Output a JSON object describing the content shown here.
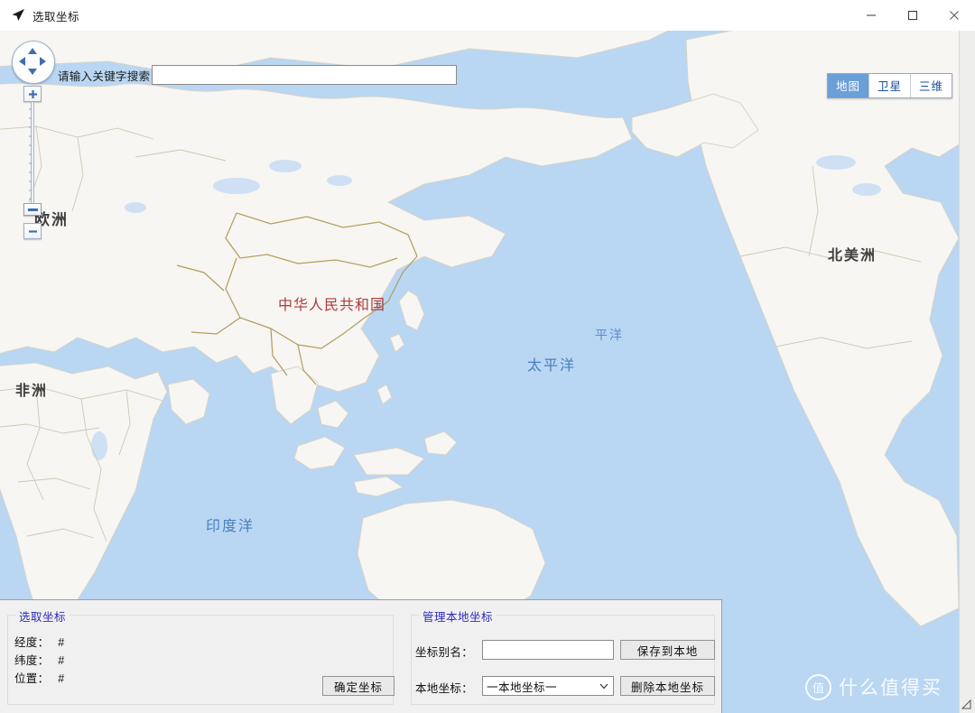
{
  "window": {
    "title": "选取坐标",
    "icon": "navigation-arrow-icon",
    "controls": {
      "minimize": "minimize-icon",
      "maximize": "maximize-icon",
      "close": "close-icon"
    }
  },
  "search": {
    "label": "请输入关键字搜索",
    "value": "",
    "placeholder": ""
  },
  "map": {
    "type_buttons": [
      {
        "label": "地图",
        "active": true
      },
      {
        "label": "卫星",
        "active": false
      },
      {
        "label": "三维",
        "active": false
      }
    ],
    "controls": {
      "pan": "pan-compass-icon",
      "zoom_in": "+",
      "zoom_out": "−"
    },
    "labels": [
      {
        "text": "欧洲",
        "kind": "continent"
      },
      {
        "text": "非洲",
        "kind": "continent"
      },
      {
        "text": "北美洲",
        "kind": "continent"
      },
      {
        "text": "中华人民共和国",
        "kind": "country"
      },
      {
        "text": "平洋",
        "kind": "ocean-small"
      },
      {
        "text": "太平洋",
        "kind": "ocean"
      },
      {
        "text": "印度洋",
        "kind": "ocean"
      }
    ],
    "colors": {
      "ocean": "#b9d6f2",
      "land": "#f7f6f3",
      "border": "#b0a060",
      "country_label": "#b03a3a",
      "ocean_label": "#4a7fc1"
    }
  },
  "watermark": {
    "logo": "值",
    "text": "什么值得买"
  },
  "panels": {
    "pick": {
      "title": "选取坐标",
      "rows": [
        {
          "label": "经度：",
          "value": "#"
        },
        {
          "label": "纬度：",
          "value": "#"
        },
        {
          "label": "位置：",
          "value": "#"
        }
      ],
      "confirm_label": "确定坐标"
    },
    "manage": {
      "title": "管理本地坐标",
      "alias_label": "坐标别名：",
      "alias_value": "",
      "save_label": "保存到本地",
      "local_label": "本地坐标：",
      "local_selected": "一本地坐标一",
      "local_options": [
        "一本地坐标一"
      ],
      "delete_label": "删除本地坐标"
    }
  }
}
